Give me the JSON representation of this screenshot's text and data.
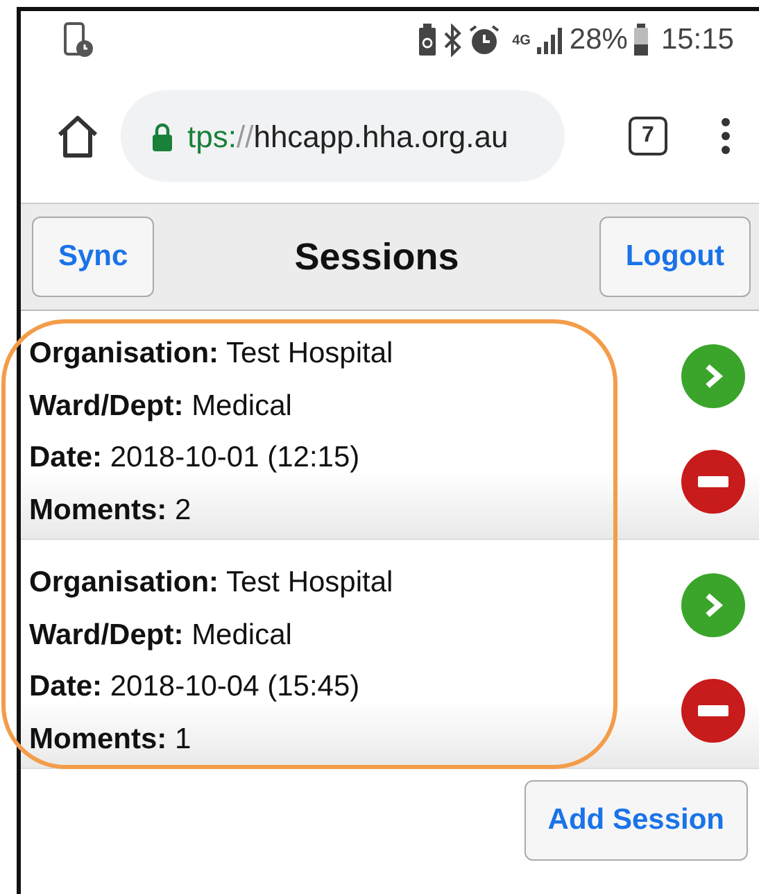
{
  "status_bar": {
    "network": "4G",
    "battery": "28%",
    "time": "15:15"
  },
  "browser": {
    "url_scheme": "tps:",
    "url_rest": "//hhcapp.hha.org.au",
    "tab_count": "7"
  },
  "header": {
    "title": "Sessions",
    "left_button": "Sync",
    "right_button": "Logout"
  },
  "sessions": [
    {
      "fields": [
        {
          "label": "Organisation:",
          "value": "Test Hospital"
        },
        {
          "label": "Ward/Dept:",
          "value": "Medical"
        },
        {
          "label": "Date:",
          "value": "2018-10-01 (12:15)"
        },
        {
          "label": "Moments:",
          "value": "2"
        }
      ]
    },
    {
      "fields": [
        {
          "label": "Organisation:",
          "value": "Test Hospital"
        },
        {
          "label": "Ward/Dept:",
          "value": "Medical"
        },
        {
          "label": "Date:",
          "value": "2018-10-04 (15:45)"
        },
        {
          "label": "Moments:",
          "value": "1"
        }
      ]
    }
  ],
  "footer_button": "Add Session"
}
